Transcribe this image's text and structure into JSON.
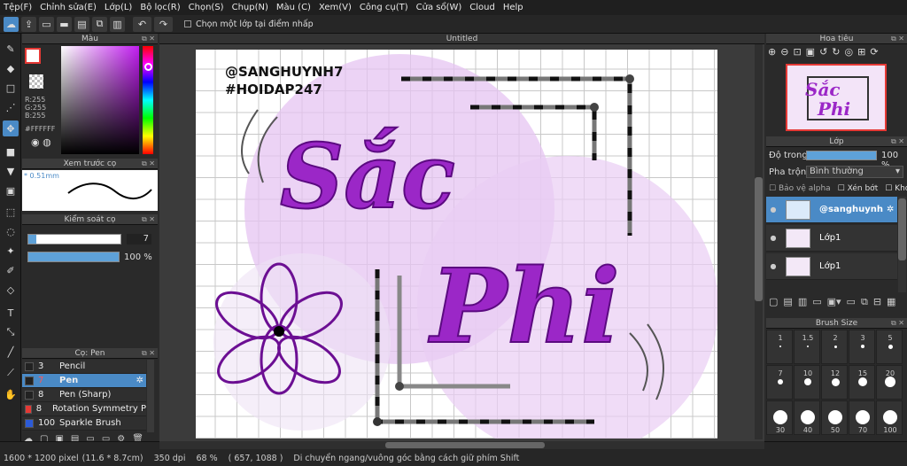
{
  "menu": [
    "Tệp(F)",
    "Chỉnh sửa(E)",
    "Lớp(L)",
    "Bộ lọc(R)",
    "Chọn(S)",
    "Chụp(N)",
    "Màu (C)",
    "Xem(V)",
    "Công cụ(T)",
    "Cửa sổ(W)",
    "Cloud",
    "Help"
  ],
  "toolbar": {
    "select_layer_label": "Chọn một lớp tại điểm nhấp"
  },
  "document": {
    "title": "Untitled"
  },
  "color_panel": {
    "title": "Màu",
    "r": "R:255",
    "g": "G:255",
    "b": "B:255",
    "hex": "#FFFFFF"
  },
  "brush_preview": {
    "title": "Xem trước cọ",
    "size": "* 0.51mm"
  },
  "brush_control": {
    "title": "Kiểm soát cọ",
    "size_value": "7",
    "opacity_value": "100 %",
    "size_fraction": 0.09,
    "opacity_fraction": 1.0
  },
  "brush_list": {
    "title": "Cọ: Pen",
    "items": [
      {
        "size": "3",
        "name": "Pencil",
        "color": "#222222"
      },
      {
        "size": "7",
        "name": "Pen",
        "color": "#222222",
        "selected": true
      },
      {
        "size": "8",
        "name": "Pen (Sharp)",
        "color": "#222222"
      },
      {
        "size": "8",
        "name": "Rotation Symmetry P",
        "color": "#e53935"
      },
      {
        "size": "100",
        "name": "Sparkle Brush",
        "color": "#2c5bd8"
      }
    ]
  },
  "navigator": {
    "title": "Hoa tiêu"
  },
  "layer_panel": {
    "title": "Lớp",
    "opacity_label": "Độ trong",
    "opacity_value": "100 %",
    "blend_label": "Pha trộn",
    "blend_value": "Bình thường",
    "protect_alpha": "Bảo vệ alpha",
    "clipping": "Xén bớt",
    "lock": "Khóa",
    "layers": [
      {
        "name": "@sanghuynh",
        "selected": true
      },
      {
        "name": "Lớp1"
      },
      {
        "name": "Lớp1"
      }
    ]
  },
  "brush_size": {
    "title": "Brush Size",
    "rows": [
      [
        "1",
        "1.5",
        "2",
        "3",
        "5"
      ],
      [
        "7",
        "10",
        "12",
        "15",
        "20"
      ],
      [
        "30",
        "40",
        "50",
        "70",
        "100"
      ]
    ]
  },
  "artwork": {
    "credit1": "@SANGHUYNH7",
    "credit2": "#HOIDAP247",
    "word1": "Sắc",
    "word2": "Phi"
  },
  "status": {
    "size": "1600 * 1200 pixel",
    "cm": "(11.6 * 8.7cm)",
    "dpi": "350 dpi",
    "zoom": "68 %",
    "coords": "( 657, 1088 )",
    "hint": "Di chuyển ngang/vuông góc bằng cách giữ phím Shift"
  },
  "colors": {
    "accent": "#4a8ac6",
    "canvas_purple": "#9b27c7",
    "lavender": "#e7c9f2"
  }
}
